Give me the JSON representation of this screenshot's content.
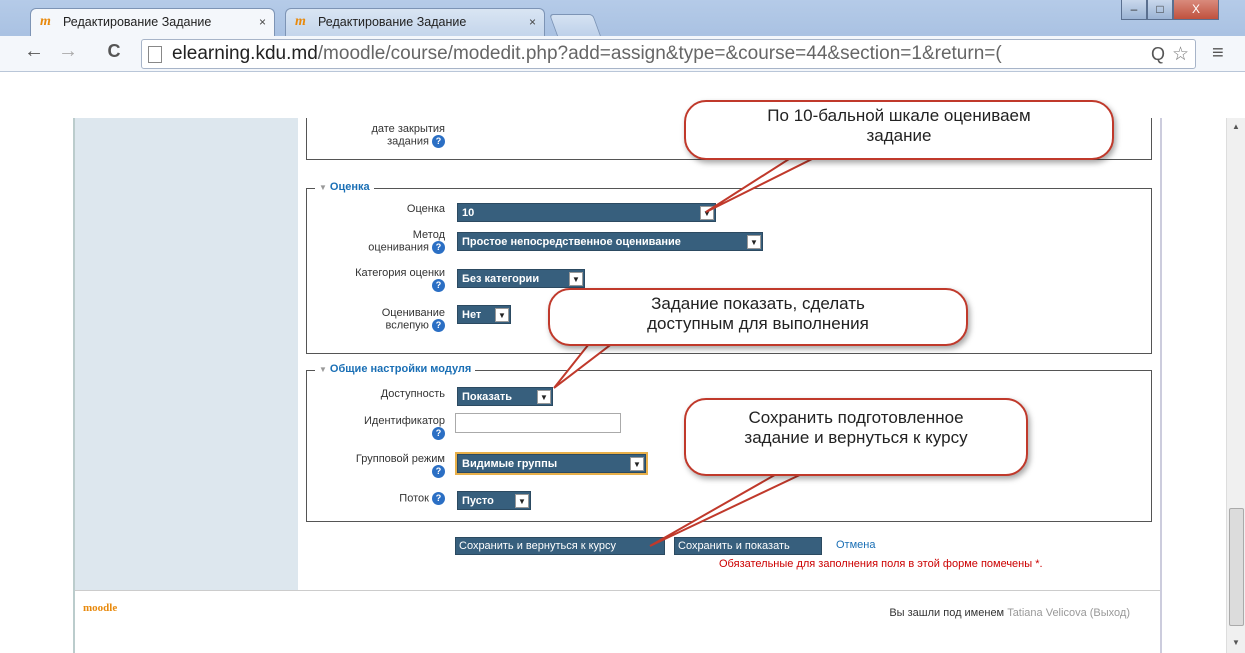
{
  "browser": {
    "tabs": [
      {
        "label": "Редактирование Задание",
        "close": "×"
      },
      {
        "label": "Редактирование Задание",
        "close": "×"
      }
    ],
    "url_host": "elearning.kdu.md",
    "url_rest": "/moodle/course/modedit.php?add=assign&type=&course=44&section=1&return=(",
    "window_controls": {
      "minimize": "–",
      "maximize": "□",
      "close": "X"
    },
    "nav": {
      "back": "←",
      "forward": "→",
      "reload": "C",
      "menu": "≡",
      "zoom": "Q",
      "star": "☆"
    }
  },
  "form": {
    "top_label_1": "дате закрытия",
    "top_label_2": "задания",
    "grade_section": {
      "legend": "Оценка",
      "grade_label": "Оценка",
      "grade_value": "10",
      "method_label_1": "Метод",
      "method_label_2": "оценивания",
      "method_value": "Простое непосредственное оценивание",
      "category_label": "Категория оценки",
      "category_value": "Без категории",
      "blind_label_1": "Оценивание",
      "blind_label_2": "вслепую",
      "blind_value": "Нет"
    },
    "common_section": {
      "legend": "Общие настройки модуля",
      "visibility_label": "Доступность",
      "visibility_value": "Показать",
      "idnumber_label": "Идентификатор",
      "idnumber_value": "",
      "groupmode_label": "Групповой режим",
      "groupmode_value": "Видимые группы",
      "grouping_label": "Поток",
      "grouping_value": "Пусто"
    },
    "buttons": {
      "save_return": "Сохранить и вернуться к курсу",
      "save_display": "Сохранить и показать",
      "cancel": "Отмена"
    },
    "required_note": "Обязательные для заполнения поля в этой форме помечены",
    "required_mark": "*."
  },
  "footer": {
    "logo": "moodle",
    "logged_in_prefix": "Вы зашли под именем",
    "user": "Tatiana Velicova",
    "logout": "(Выход)"
  },
  "callouts": {
    "grade_1": "По 10-бальной шкале оцениваем",
    "grade_2": "задание",
    "visibility_1": "Задание показать, сделать",
    "visibility_2": "доступным для выполнения",
    "save_1": "Сохранить подготовленное",
    "save_2": "задание и вернуться к курсу"
  },
  "colors": {
    "callout_border": "#c0392b",
    "select_bg": "#375f7d",
    "link": "#1a6fb5",
    "sidebar": "#dde7ee"
  }
}
